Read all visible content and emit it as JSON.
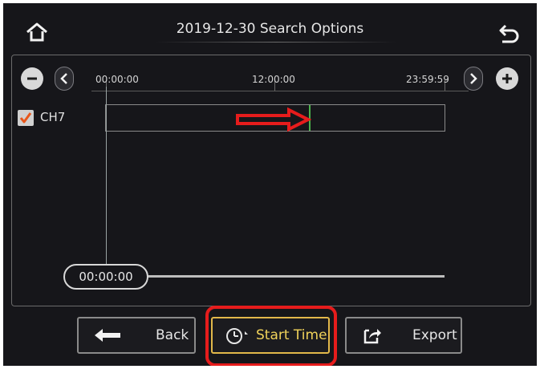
{
  "header": {
    "title": "2019-12-30  Search Options",
    "home_icon": "home-icon",
    "back_icon": "return-icon"
  },
  "timeline": {
    "zoom_out_icon": "minus-icon",
    "zoom_in_icon": "plus-icon",
    "prev_icon": "chevron-left-icon",
    "next_icon": "chevron-right-icon",
    "ticks": [
      "00:00:00",
      "12:00:00",
      "23:59:59"
    ],
    "record_mark_fraction": 0.6
  },
  "channels": [
    {
      "label": "CH7",
      "checked": true
    }
  ],
  "playback": {
    "time": "00:00:00"
  },
  "footer": {
    "back_label": "Back",
    "start_time_label": "Start Time",
    "export_label": "Export"
  },
  "colors": {
    "background": "#16161a",
    "highlight": "#e61c1c",
    "accent": "#f0d25a",
    "record": "#4bb34b",
    "checkbox_check": "#e8561a"
  }
}
